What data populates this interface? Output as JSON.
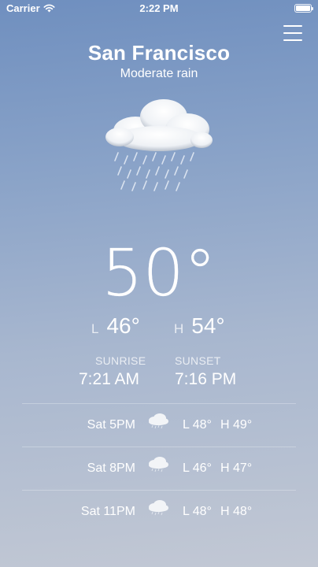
{
  "status": {
    "carrier": "Carrier",
    "time": "2:22 PM"
  },
  "location": {
    "city": "San Francisco",
    "condition": "Moderate rain"
  },
  "current": {
    "temperature": "50°",
    "low_label": "L",
    "low": "46°",
    "high_label": "H",
    "high": "54°"
  },
  "sun": {
    "sunrise_label": "SUNRISE",
    "sunrise": "7:21 AM",
    "sunset_label": "SUNSET",
    "sunset": "7:16 PM"
  },
  "forecast": [
    {
      "time": "Sat 5PM",
      "low": "L 48°",
      "high": "H 49°",
      "icon": "rain-cloud-icon"
    },
    {
      "time": "Sat 8PM",
      "low": "L 46°",
      "high": "H 47°",
      "icon": "rain-cloud-icon"
    },
    {
      "time": "Sat 11PM",
      "low": "L 48°",
      "high": "H 48°",
      "icon": "rain-cloud-icon"
    }
  ],
  "icons": {
    "main": "rain-cloud-icon",
    "menu": "hamburger-menu-icon",
    "wifi": "wifi-icon",
    "battery": "battery-icon"
  }
}
